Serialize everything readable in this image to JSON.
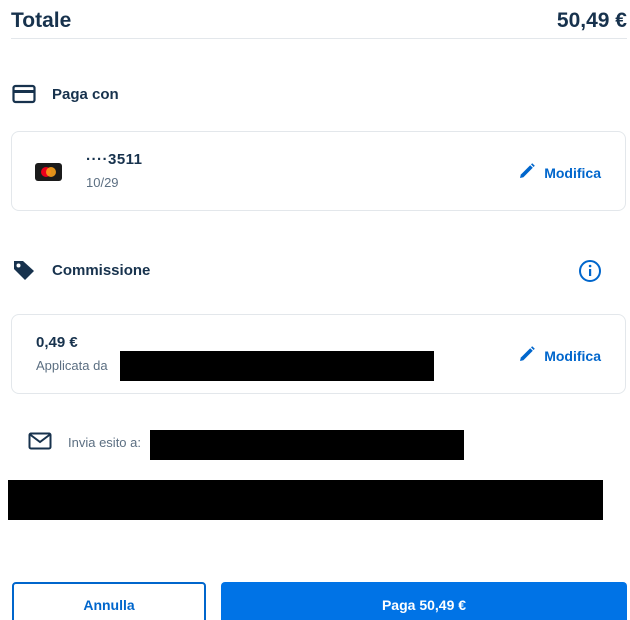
{
  "total": {
    "label": "Totale",
    "amount": "50,49 €"
  },
  "payment": {
    "header": "Paga con",
    "header_icon": "credit-card-icon",
    "card": {
      "brand_icon": "mastercard-icon",
      "number": "····3511",
      "expiry": "10/29"
    },
    "edit_label": "Modifica"
  },
  "fee": {
    "header": "Commissione",
    "header_icon": "tag-icon",
    "info_icon": "info-icon",
    "amount": "0,49 €",
    "applied_by_label": "Applicata da",
    "edit_label": "Modifica"
  },
  "email": {
    "icon": "mail-icon",
    "label": "Invia esito a:"
  },
  "actions": {
    "cancel_label": "Annulla",
    "pay_label": "Paga 50,49 €"
  },
  "colors": {
    "primary": "#0066cc",
    "primary_button": "#0073e6",
    "text_dark": "#17324d",
    "text_muted": "#5c6f82",
    "border": "#e3e7eb"
  }
}
